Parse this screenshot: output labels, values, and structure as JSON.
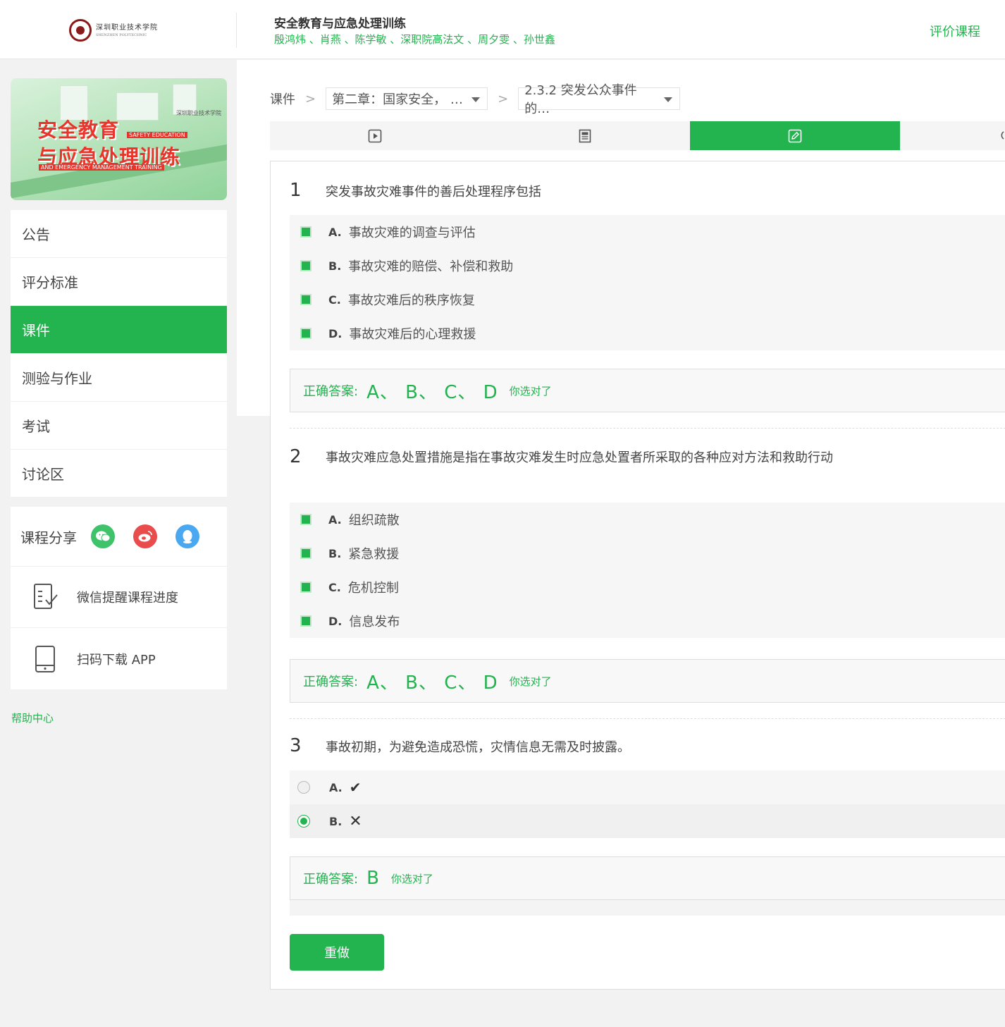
{
  "header": {
    "logo_text": "深圳职业技术学院",
    "logo_sub": "SHENZHEN POLYTECHNIC",
    "course_title": "安全教育与应急处理训练",
    "teachers": "殷鸿炜 、肖燕 、陈学敏 、深职院高法文 、周夕雯 、孙世鑫",
    "rate_label": "评价课程"
  },
  "cover": {
    "title_line1": "安全教育",
    "title_line2": "与应急处理训练",
    "en_line1": "SAFETY EDUCATION",
    "en_line2": "AND EMERGENCY MANAGEMENT TRAINING",
    "seal_text": "深圳职业技术学院"
  },
  "nav": {
    "items": [
      "公告",
      "评分标准",
      "课件",
      "测验与作业",
      "考试",
      "讨论区"
    ],
    "active_index": 2
  },
  "share": {
    "label": "课程分享",
    "wechat_remind": "微信提醒课程进度",
    "download_app": "扫码下载 APP"
  },
  "help_label": "帮助中心",
  "breadcrumb": {
    "root": "课件",
    "chapter": "第二章：国家安全，  …",
    "section": "2.3.2 突发公众事件的…"
  },
  "tabs": [
    "video",
    "document",
    "quiz",
    "discussion"
  ],
  "questions": [
    {
      "num": "1",
      "text": "突发事故灾难事件的善后处理程序包括",
      "options": [
        {
          "letter": "A.",
          "text": "事故灾难的调查与评估"
        },
        {
          "letter": "B.",
          "text": "事故灾难的赔偿、补偿和救助"
        },
        {
          "letter": "C.",
          "text": "事故灾难后的秩序恢复"
        },
        {
          "letter": "D.",
          "text": "事故灾难后的心理救援"
        }
      ],
      "answer_label": "正确答案:",
      "answer": "A、 B、 C、 D",
      "result": "你选对了"
    },
    {
      "num": "2",
      "text": "事故灾难应急处置措施是指在事故灾难发生时应急处置者所采取的各种应对方法和救助行动",
      "options": [
        {
          "letter": "A.",
          "text": "组织疏散"
        },
        {
          "letter": "B.",
          "text": "紧急救援"
        },
        {
          "letter": "C.",
          "text": "危机控制"
        },
        {
          "letter": "D.",
          "text": "信息发布"
        }
      ],
      "answer_label": "正确答案:",
      "answer": "A、 B、 C、 D",
      "result": "你选对了"
    },
    {
      "num": "3",
      "text": "事故初期，为避免造成恐慌，灾情信息无需及时披露。",
      "options": [
        {
          "letter": "A.",
          "text": "✔",
          "selected": false
        },
        {
          "letter": "B.",
          "text": "✕",
          "selected": true
        }
      ],
      "answer_label": "正确答案:",
      "answer": "B",
      "result": "你选对了"
    }
  ],
  "redo_label": "重做",
  "colors": {
    "accent": "#23b34f"
  }
}
